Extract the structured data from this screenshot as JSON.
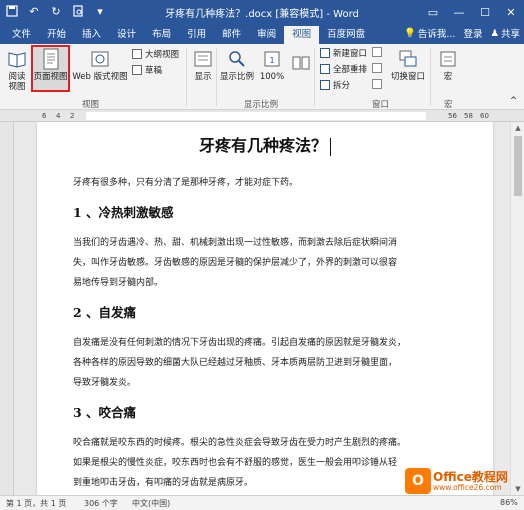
{
  "window": {
    "title": "牙疼有几种疼法？.docx [兼容模式] - Word",
    "qat": [
      "save-icon",
      "undo-icon",
      "redo-icon",
      "print-preview-icon",
      "customize-icon"
    ]
  },
  "tabs": [
    "文件",
    "开始",
    "插入",
    "设计",
    "布局",
    "引用",
    "邮件",
    "审阅",
    "视图",
    "百度网盘"
  ],
  "active_tab": "视图",
  "tabs_right": {
    "tell_me": "告诉我...",
    "login": "登录",
    "share": "共享"
  },
  "ribbon": {
    "read_mode": "阅读视图",
    "print_layout": "页面视图",
    "web_layout": "Web 版式视图",
    "outline": "大纲视图",
    "draft": "草稿",
    "show": "显示",
    "zoom": "显示比例",
    "zoom_100": "100%",
    "new_window": "新建窗口",
    "arrange_all": "全部重排",
    "split": "拆分",
    "switch_windows": "切换窗口",
    "macros": "宏",
    "group_views": "视图",
    "group_zoom": "显示比例",
    "group_window": "窗口",
    "group_macros": "宏"
  },
  "ruler": {
    "left_numbers": [
      "6",
      "4",
      "2"
    ],
    "right_numbers": [
      "56",
      "58",
      "60"
    ]
  },
  "document": {
    "title": "牙疼有几种疼法？",
    "intro": "牙疼有很多种，只有分清了是那种牙疼，才能对症下药。",
    "sections": [
      {
        "heading": "1 、冷热刺激敏感",
        "lines": [
          "当我们的牙齿遇冷、热、甜、机械刺激出现一过性敏感，而刺激去除后症状瞬间消",
          "失，叫作牙齿敏感。牙齿敏感的原因是牙髓的保护层减少了，外界的刺激可以很容",
          "易地传导到牙髓内部。"
        ]
      },
      {
        "heading": "2 、自发痛",
        "lines": [
          "自发痛是没有任何刺激的情况下牙齿出现的疼痛。引起自发痛的原因就是牙髓发炎，",
          "各种各样的原因导致的细菌大队已经越过牙釉质、牙本质两层防卫进到牙髓里面，",
          "导致牙髓发炎。"
        ]
      },
      {
        "heading": "3 、咬合痛",
        "lines": [
          "咬合痛就是咬东西的时候疼。根尖的急性炎症会导致牙齿在受力时产生剧烈的疼痛。",
          "如果是根尖的慢性炎症，咬东西时也会有不舒服的感觉，医生一般会用叩诊锤从轻",
          "到重地叩击牙齿，有叩痛的牙齿就是病原牙。"
        ]
      }
    ]
  },
  "status": {
    "page": "第 1 页，共 1 页",
    "words": "306 个字",
    "lang": "中文(中国)",
    "zoom": "86%"
  },
  "watermark": {
    "name": "Office教程网",
    "url": "www.office26.com"
  },
  "colors": {
    "brand": "#2b579a",
    "highlight_box": "#e02020",
    "watermark": "#ff7a00"
  }
}
